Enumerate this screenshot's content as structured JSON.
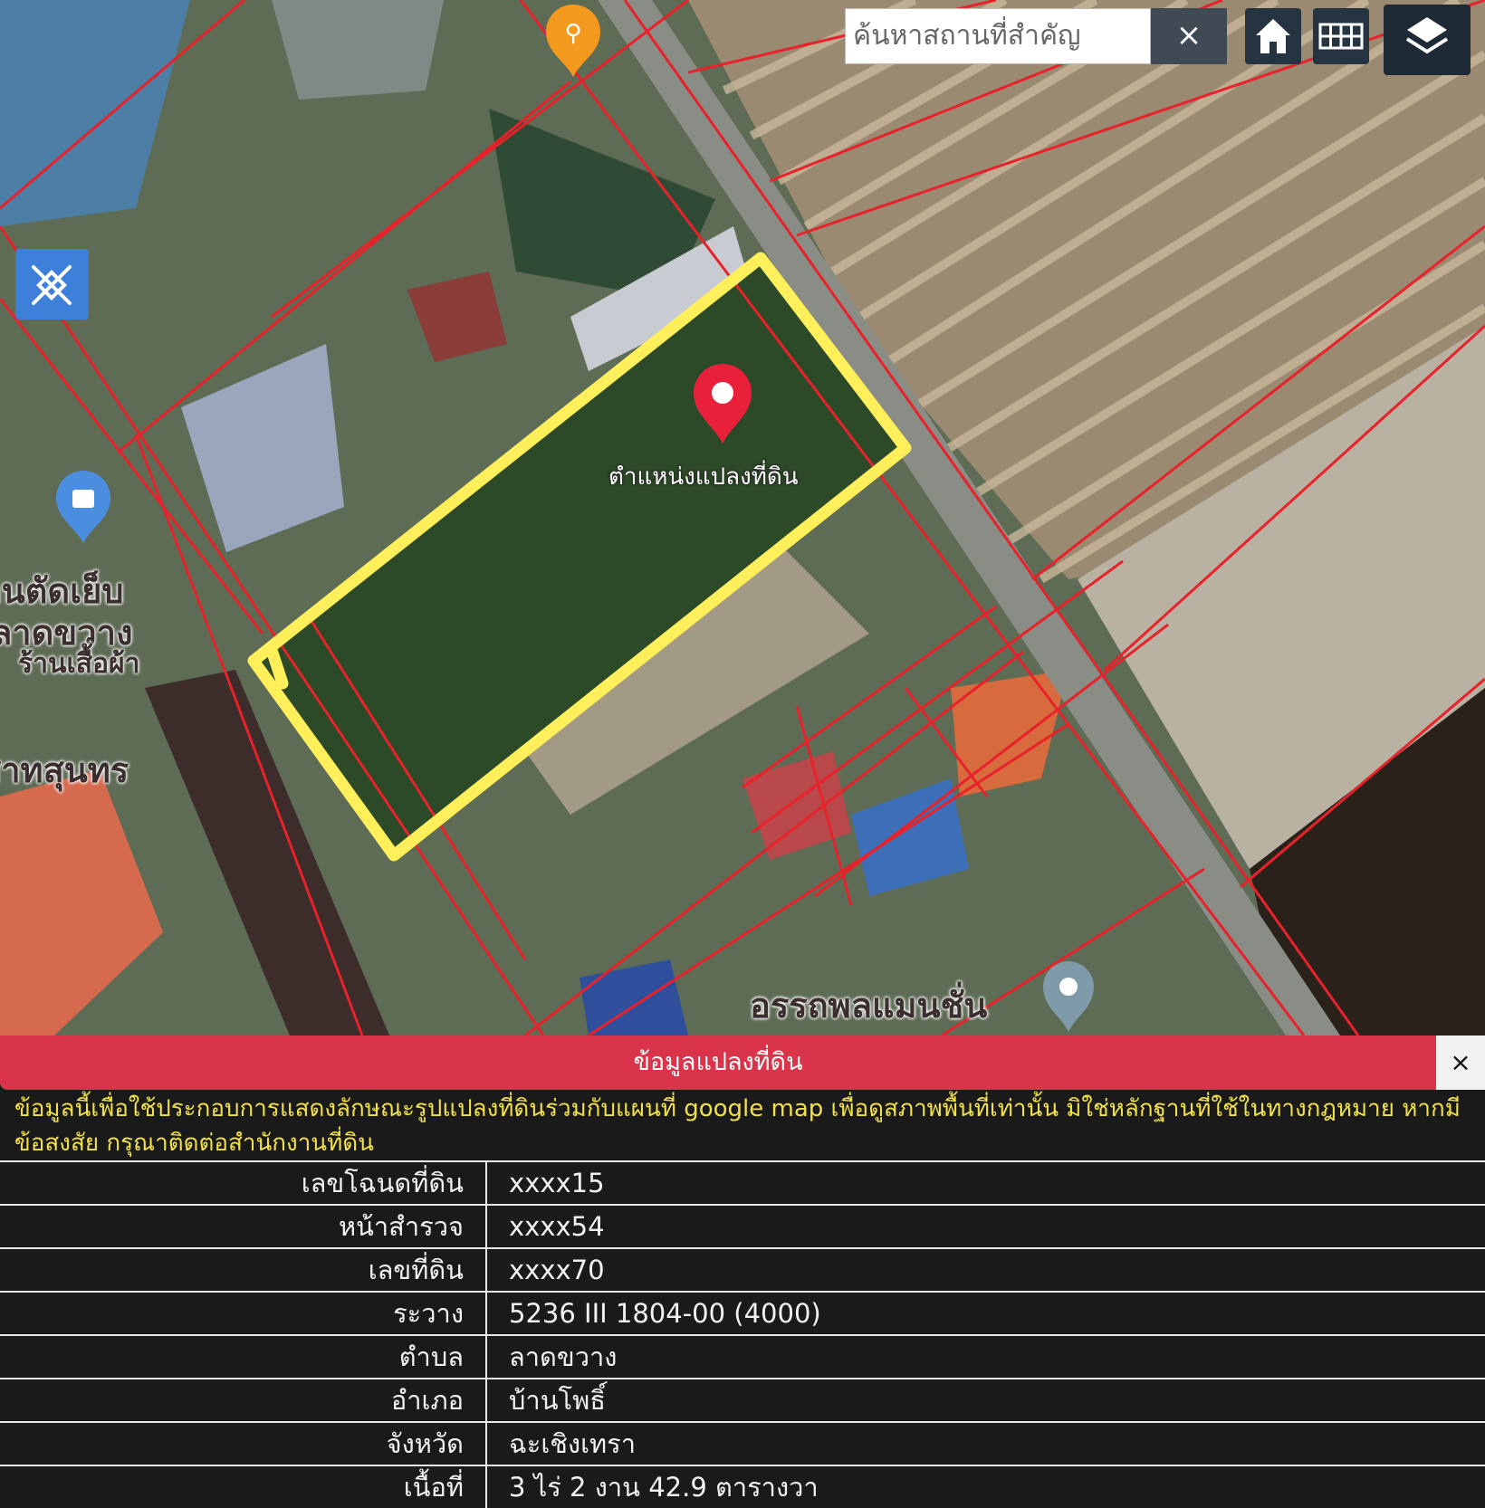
{
  "search": {
    "placeholder": "ค้นหาสถานที่สำคัญ",
    "clear_label": "×"
  },
  "toolbar": {
    "home_icon": "home-icon",
    "grid_icon": "grid-icon",
    "layers_icon": "layers-icon"
  },
  "measure_tool": {
    "icon": "ruler-pencil-icon"
  },
  "map": {
    "labels": [
      {
        "id": "map-label-shop-1",
        "text": "ร้านตัดเย็บ"
      },
      {
        "id": "map-label-shop-2",
        "text": "ลาดขวาง"
      },
      {
        "id": "map-label-shop-3",
        "text": "ร้านเสื้อผ้า"
      },
      {
        "id": "map-label-place",
        "text": "สาทสุนทร"
      },
      {
        "id": "map-label-mansion",
        "text": "อรรถพลแมนชั่น"
      },
      {
        "id": "map-label-parcel",
        "text": "ตำแหน่งแปลงที่ดิน"
      }
    ],
    "colors": {
      "parcel_outline": "#ffef5a",
      "boundary": "#e8222a",
      "marker": "#e8203a"
    }
  },
  "panel": {
    "title": "ข้อมูลแปลงที่ดิน",
    "close_label": "×",
    "disclaimer": "ข้อมูลนี้เพื่อใช้ประกอบการแสดงลักษณะรูปแปลงที่ดินร่วมกับแผนที่ google map เพื่อดูสภาพพื้นที่เท่านั้น มิใช่หลักฐานที่ใช้ในทางกฎหมาย หากมีข้อสงสัย กรุณาติดต่อสำนักงานที่ดิน",
    "rows": [
      {
        "label": "เลขโฉนดที่ดิน",
        "value": "xxxx15"
      },
      {
        "label": "หน้าสำรวจ",
        "value": "xxxx54"
      },
      {
        "label": "เลขที่ดิน",
        "value": "xxxx70"
      },
      {
        "label": "ระวาง",
        "value": "5236 III 1804-00 (4000)"
      },
      {
        "label": "ตำบล",
        "value": "ลาดขวาง"
      },
      {
        "label": "อำเภอ",
        "value": "บ้านโพธิ์"
      },
      {
        "label": "จังหวัด",
        "value": "ฉะเชิงเทรา"
      },
      {
        "label": "เนื้อที่",
        "value": "3 ไร่ 2 งาน 42.9 ตารางวา"
      }
    ]
  }
}
